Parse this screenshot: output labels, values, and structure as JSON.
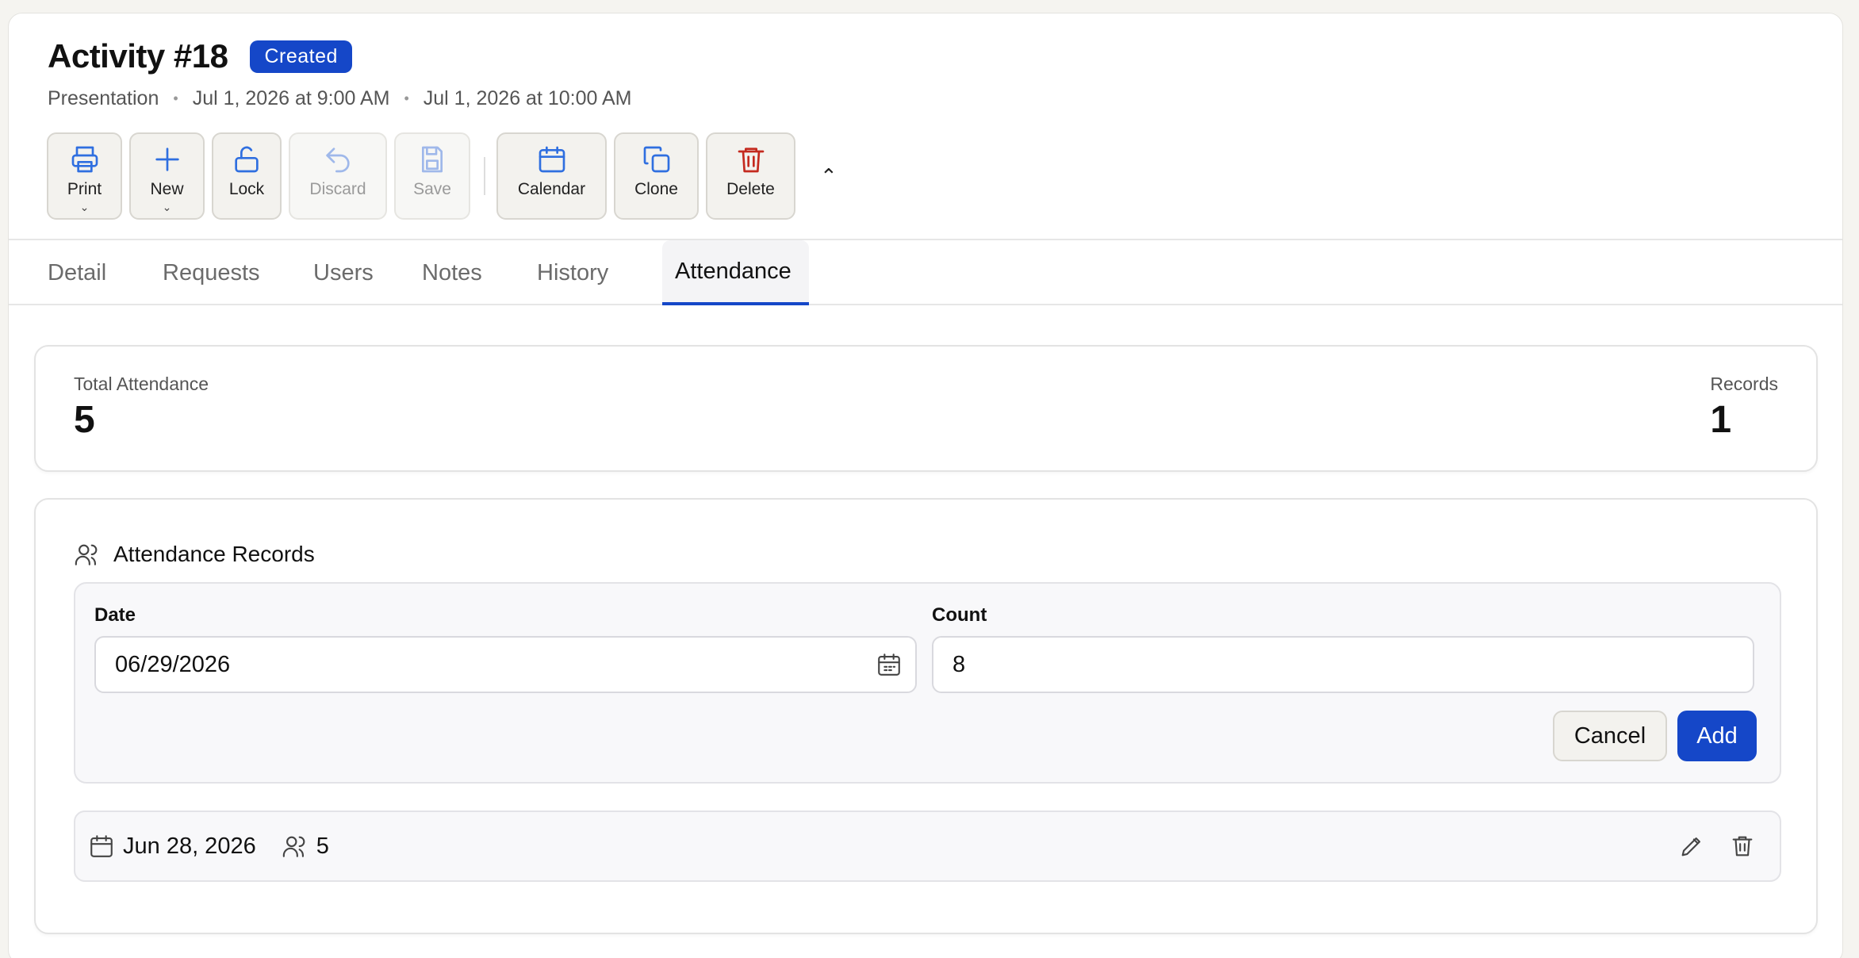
{
  "activity": {
    "title": "Activity #18",
    "status": "Created",
    "type": "Presentation",
    "start": "Jul 1, 2026 at 9:00 AM",
    "end": "Jul 1, 2026 at 10:00 AM"
  },
  "toolbar": {
    "print": "Print",
    "new": "New",
    "lock": "Lock",
    "discard": "Discard",
    "save": "Save",
    "calendar": "Calendar",
    "clone": "Clone",
    "delete": "Delete"
  },
  "tabs": [
    "Detail",
    "Requests",
    "Users",
    "Notes",
    "History",
    "Attendance"
  ],
  "active_tab": "Attendance",
  "stats": {
    "total_label": "Total Attendance",
    "total_value": "5",
    "records_label": "Records",
    "records_value": "1"
  },
  "records_section": {
    "title": "Attendance Records",
    "date_label": "Date",
    "date_value": "06/29/2026",
    "count_label": "Count",
    "count_value": "8",
    "cancel": "Cancel",
    "add": "Add"
  },
  "records": [
    {
      "date": "Jun 28, 2026",
      "count": "5"
    }
  ],
  "colors": {
    "accent": "#1547c8",
    "icon_blue": "#2f6fe0",
    "danger": "#c42a1f"
  }
}
